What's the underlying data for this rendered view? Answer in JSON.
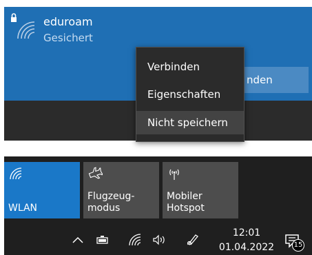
{
  "network": {
    "name": "eduroam",
    "status": "Gesichert",
    "connect_label": "nden"
  },
  "context_menu": {
    "items": [
      {
        "label": "Verbinden"
      },
      {
        "label": "Eigenschaften"
      },
      {
        "label": "Nicht speichern"
      }
    ]
  },
  "quick_actions": [
    {
      "label": "WLAN",
      "icon": "wifi-icon",
      "active": true
    },
    {
      "label": "Flugzeug-\nmodus",
      "icon": "airplane-icon",
      "active": false
    },
    {
      "label": "Mobiler\nHotspot",
      "icon": "hotspot-icon",
      "active": false
    }
  ],
  "taskbar": {
    "time": "12:01",
    "date": "01.04.2022",
    "notification_count": "15",
    "tray_icons": [
      "chevron-up-icon",
      "battery-icon",
      "wifi-icon",
      "volume-icon",
      "pen-icon",
      "notification-icon"
    ]
  },
  "colors": {
    "accent": "#1a78c8",
    "network_selected": "#1f6fb4",
    "tile_inactive": "#4d4d4d",
    "background": "#1f1f1f"
  }
}
